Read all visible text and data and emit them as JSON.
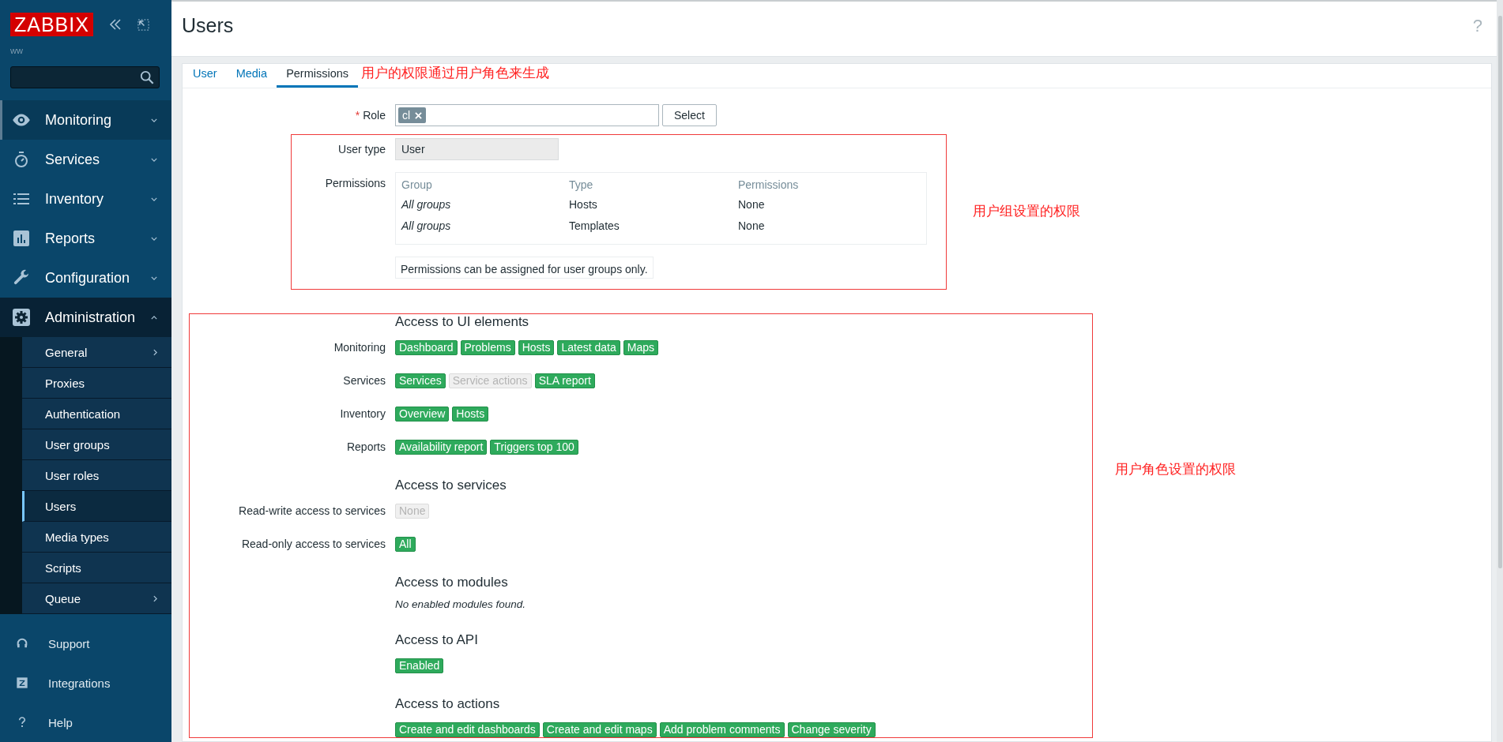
{
  "sidebar": {
    "logo": "ZABBIX",
    "user": "ww",
    "menu": [
      {
        "label": "Monitoring",
        "expanded": false,
        "hovered": true
      },
      {
        "label": "Services",
        "expanded": false,
        "hovered": false
      },
      {
        "label": "Inventory",
        "expanded": false,
        "hovered": false
      },
      {
        "label": "Reports",
        "expanded": false,
        "hovered": false
      },
      {
        "label": "Configuration",
        "expanded": false,
        "hovered": false
      },
      {
        "label": "Administration",
        "expanded": true,
        "hovered": false,
        "children": [
          {
            "label": "General",
            "submenu": true,
            "selected": false
          },
          {
            "label": "Proxies",
            "submenu": false,
            "selected": false
          },
          {
            "label": "Authentication",
            "submenu": false,
            "selected": false
          },
          {
            "label": "User groups",
            "submenu": false,
            "selected": false
          },
          {
            "label": "User roles",
            "submenu": false,
            "selected": false
          },
          {
            "label": "Users",
            "submenu": false,
            "selected": true
          },
          {
            "label": "Media types",
            "submenu": false,
            "selected": false
          },
          {
            "label": "Scripts",
            "submenu": false,
            "selected": false
          },
          {
            "label": "Queue",
            "submenu": true,
            "selected": false
          }
        ]
      }
    ],
    "footer": [
      {
        "label": "Support"
      },
      {
        "label": "Integrations"
      },
      {
        "label": "Help"
      }
    ]
  },
  "header": {
    "title": "Users",
    "help": "?"
  },
  "tabs": [
    {
      "label": "User",
      "selected": false
    },
    {
      "label": "Media",
      "selected": false
    },
    {
      "label": "Permissions",
      "selected": true
    }
  ],
  "annotations": [
    "用户的权限通过用户角色来生成",
    "用户组设置的权限",
    "用户角色设置的权限"
  ],
  "form": {
    "role": {
      "label": "Role",
      "required_mark": "*",
      "value": "cl",
      "button": "Select"
    },
    "user_type": {
      "label": "User type",
      "value": "User"
    },
    "permissions": {
      "label": "Permissions",
      "columns": [
        "Group",
        "Type",
        "Permissions"
      ],
      "rows": [
        [
          "All groups",
          "Hosts",
          "None"
        ],
        [
          "All groups",
          "Templates",
          "None"
        ]
      ],
      "note": "Permissions can be assigned for user groups only."
    },
    "sections": [
      {
        "title": "Access to UI elements",
        "rows": [
          {
            "label": "Monitoring",
            "tags": [
              {
                "label": "Dashboard",
                "enabled": true
              },
              {
                "label": "Problems",
                "enabled": true
              },
              {
                "label": "Hosts",
                "enabled": true
              },
              {
                "label": "Latest data",
                "enabled": true
              },
              {
                "label": "Maps",
                "enabled": true
              }
            ]
          },
          {
            "label": "Services",
            "tags": [
              {
                "label": "Services",
                "enabled": true
              },
              {
                "label": "Service actions",
                "enabled": false
              },
              {
                "label": "SLA report",
                "enabled": true
              }
            ]
          },
          {
            "label": "Inventory",
            "tags": [
              {
                "label": "Overview",
                "enabled": true
              },
              {
                "label": "Hosts",
                "enabled": true
              }
            ]
          },
          {
            "label": "Reports",
            "tags": [
              {
                "label": "Availability report",
                "enabled": true
              },
              {
                "label": "Triggers top 100",
                "enabled": true
              }
            ]
          }
        ]
      },
      {
        "title": "Access to services",
        "rows": [
          {
            "label": "Read-write access to services",
            "tags": [
              {
                "label": "None",
                "enabled": false
              }
            ]
          },
          {
            "label": "Read-only access to services",
            "tags": [
              {
                "label": "All",
                "enabled": true
              }
            ]
          }
        ]
      },
      {
        "title": "Access to modules",
        "message": "No enabled modules found."
      },
      {
        "title": "Access to API",
        "rows": [
          {
            "tags": [
              {
                "label": "Enabled",
                "enabled": true
              }
            ]
          }
        ]
      },
      {
        "title": "Access to actions",
        "rows": [
          {
            "tags": [
              {
                "label": "Create and edit dashboards",
                "enabled": true
              },
              {
                "label": "Create and edit maps",
                "enabled": true
              },
              {
                "label": "Add problem comments",
                "enabled": true
              },
              {
                "label": "Change severity",
                "enabled": true
              }
            ]
          }
        ]
      }
    ]
  }
}
